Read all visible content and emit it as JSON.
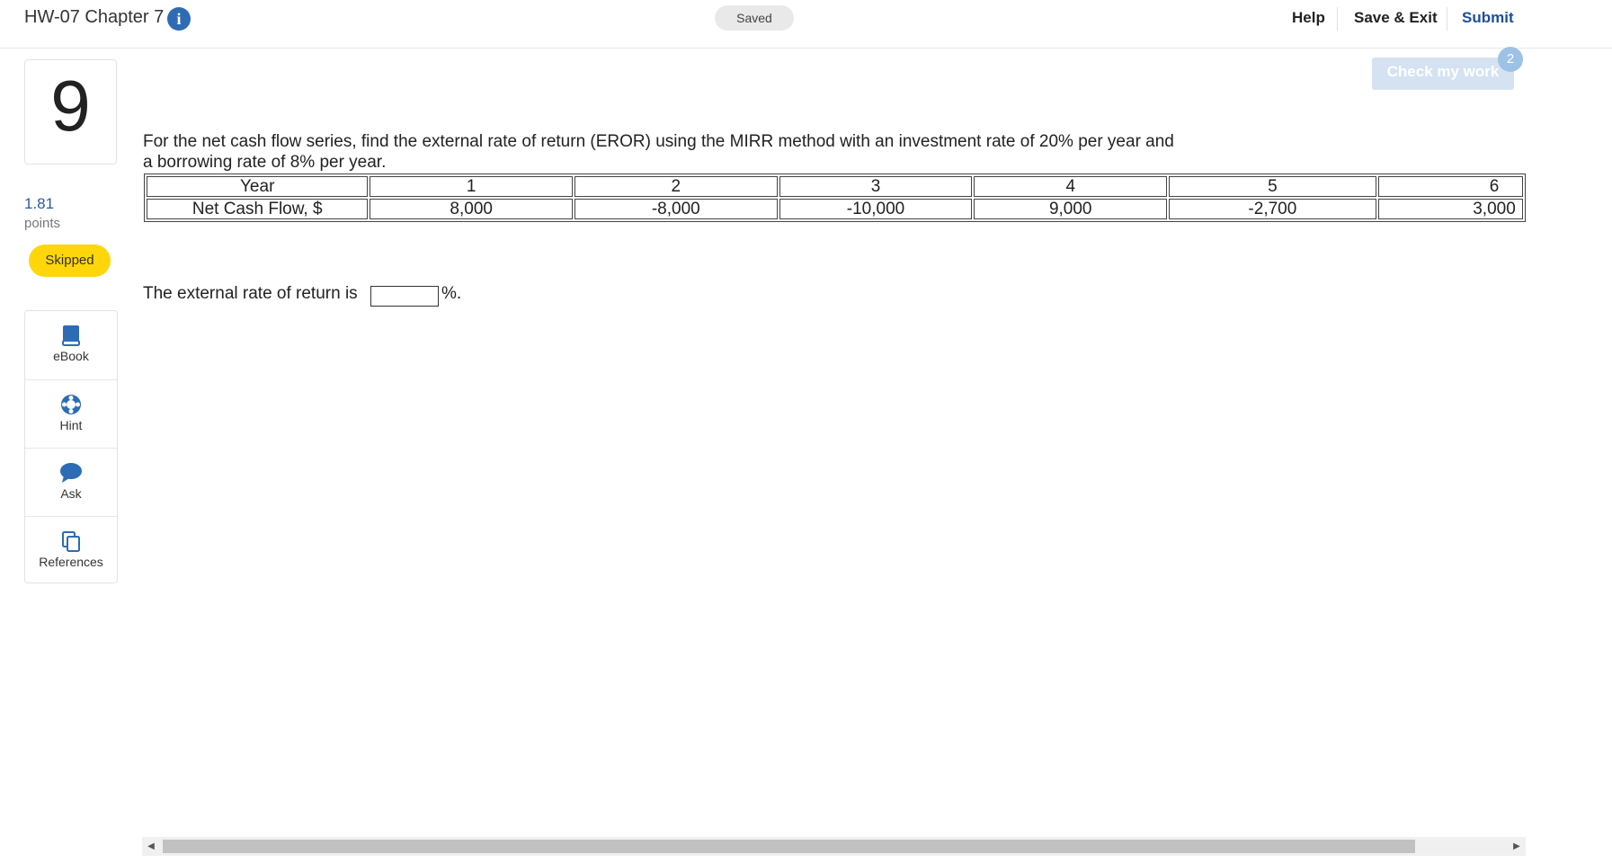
{
  "header": {
    "assignment_title": "HW-07 Chapter 7",
    "info_icon": "info-icon",
    "saved_label": "Saved",
    "nav": {
      "help": "Help",
      "save_exit": "Save & Exit",
      "submit": "Submit"
    }
  },
  "question": {
    "number": "9",
    "points_value": "1.81",
    "points_label": "points",
    "status": "Skipped",
    "text": "For the net cash flow series, find the external rate of return (EROR) using the MIRR method with an investment rate of 20% per year and a borrowing rate of 8% per year.",
    "table": {
      "header_label": "Year",
      "years": [
        "1",
        "2",
        "3",
        "4",
        "5",
        "6"
      ],
      "row_label": "Net Cash Flow, $",
      "values": [
        "8,000",
        "-8,000",
        "-10,000",
        "9,000",
        "-2,700",
        "3,000"
      ]
    },
    "answer_prompt": "The external rate of return is",
    "answer_value": "",
    "answer_unit": "%."
  },
  "check_work": {
    "label": "Check my work",
    "badge": "2"
  },
  "tools": [
    {
      "label": "eBook",
      "icon": "book-icon"
    },
    {
      "label": "Hint",
      "icon": "lifebuoy-icon"
    },
    {
      "label": "Ask",
      "icon": "speech-bubble-icon"
    },
    {
      "label": "References",
      "icon": "copy-pages-icon"
    }
  ],
  "colors": {
    "accent": "#2d6cb5",
    "skipped": "#ffd60a",
    "submit": "#1e4e9c"
  }
}
